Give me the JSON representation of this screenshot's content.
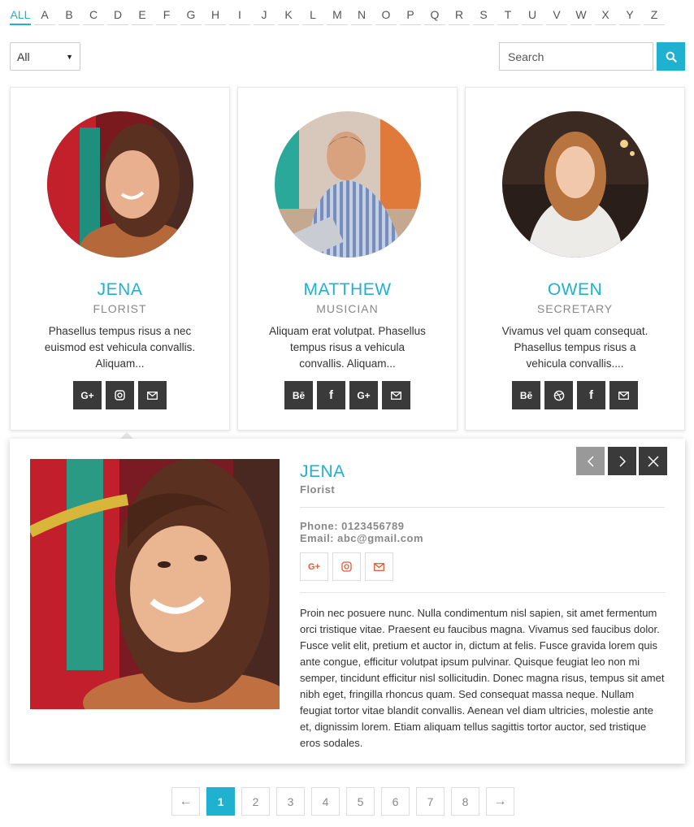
{
  "alphabet": {
    "letters": [
      "ALL",
      "A",
      "B",
      "C",
      "D",
      "E",
      "F",
      "G",
      "H",
      "I",
      "J",
      "K",
      "L",
      "M",
      "N",
      "O",
      "P",
      "Q",
      "R",
      "S",
      "T",
      "U",
      "V",
      "W",
      "X",
      "Y",
      "Z"
    ],
    "active": "ALL"
  },
  "filter": {
    "selected": "All"
  },
  "search": {
    "placeholder": "Search",
    "button_icon": "search-icon"
  },
  "members": [
    {
      "name": "JENA",
      "role": "FLORIST",
      "excerpt": "Phasellus tempus risus a nec euismod est vehicula convallis. Aliquam...",
      "socials": [
        {
          "icon": "google-plus-icon",
          "glyph": "G+"
        },
        {
          "icon": "instagram-icon",
          "glyph": ""
        },
        {
          "icon": "email-icon",
          "glyph": ""
        }
      ]
    },
    {
      "name": "MATTHEW",
      "role": "MUSICIAN",
      "excerpt": "Aliquam erat volutpat. Phasellus tempus risus a vehicula convallis. Aliquam...",
      "socials": [
        {
          "icon": "behance-icon",
          "glyph": "Bē"
        },
        {
          "icon": "facebook-icon",
          "glyph": "f"
        },
        {
          "icon": "google-plus-icon",
          "glyph": "G+"
        },
        {
          "icon": "email-icon",
          "glyph": ""
        }
      ]
    },
    {
      "name": "OWEN",
      "role": "SECRETARY",
      "excerpt": "Vivamus vel quam consequat. Phasellus tempus risus a vehicula convallis....",
      "socials": [
        {
          "icon": "behance-icon",
          "glyph": "Bē"
        },
        {
          "icon": "dribbble-icon",
          "glyph": ""
        },
        {
          "icon": "facebook-icon",
          "glyph": "f"
        },
        {
          "icon": "email-icon",
          "glyph": ""
        }
      ]
    }
  ],
  "detail": {
    "name": "JENA",
    "role": "Florist",
    "phone": "Phone: 0123456789",
    "email": "Email: abc@gmail.com",
    "socials": [
      {
        "icon": "google-plus-icon",
        "glyph": "G+"
      },
      {
        "icon": "instagram-icon",
        "glyph": ""
      },
      {
        "icon": "email-icon",
        "glyph": ""
      }
    ],
    "bio": "Proin nec posuere nunc. Nulla condimentum nisl sapien, sit amet fermentum orci tristique vitae. Praesent eu faucibus magna. Vivamus sed faucibus dolor. Fusce velit elit, pretium et auctor in, dictum at felis. Fusce gravida lorem quis ante congue, efficitur volutpat ipsum pulvinar. Quisque feugiat leo non mi semper, tincidunt efficitur nisl sollicitudin. Donec magna risus, tempus sit amet nibh eget, fringilla rhoncus quam. Sed consequat massa neque. Nullam feugiat tortor vitae blandit convallis. Aenean vel diam ultricies, molestie ante et, dignissim lorem. Etiam aliquam tellus sagittis tortor auctor, sed tristique eros sodales."
  },
  "pagination": {
    "prev": "←",
    "next": "→",
    "pages": [
      "1",
      "2",
      "3",
      "4",
      "5",
      "6",
      "7",
      "8"
    ],
    "active": "1"
  },
  "colors": {
    "accent": "#1fb2d0",
    "dark_button": "#3a3a3a",
    "social_outline": "#e8593a"
  }
}
